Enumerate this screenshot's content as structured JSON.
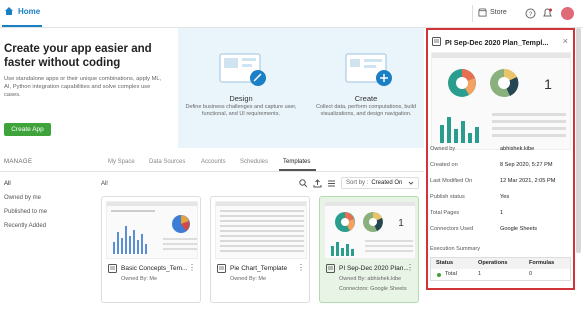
{
  "topbar": {
    "home_label": "Home",
    "store_label": "Store",
    "icons": [
      "home-icon",
      "store-icon",
      "help-icon",
      "notifications-icon",
      "avatar"
    ],
    "brand_color": "#1a7fc4",
    "avatar_color": "#e06a78"
  },
  "hero": {
    "title": "Create your app easier and faster without coding",
    "description": "Use standalone apps or their unique combinations, apply ML, AI, Python integration capabilities and solve complex use cases.",
    "create_button": "Create App",
    "steps": [
      {
        "title": "Design",
        "description": "Define business challenges and capture user, functional, and UI requirements."
      },
      {
        "title": "Create",
        "description": "Collect data, perform computations, build visualizations, and design navigation."
      }
    ]
  },
  "manage": {
    "label": "MANAGE",
    "tabs": [
      "My Space",
      "Data Sources",
      "Accounts",
      "Schedules",
      "Templates"
    ],
    "active_tab": "Templates",
    "sidebar": [
      "All",
      "Owned by me",
      "Published to me",
      "Recently Added"
    ],
    "list_label": "All",
    "sort_label": "Sort by :",
    "sort_value": "Created On"
  },
  "cards": [
    {
      "title": "Basic Concepts_Tem...",
      "owned_by": "Owned By: Me",
      "connectors": ""
    },
    {
      "title": "Pie Chart_Template",
      "owned_by": "Owned By: Me",
      "connectors": ""
    },
    {
      "title": "PI Sep-Dec 2020 Plan...",
      "owned_by": "Owned By: abhishek.kibe",
      "connectors": "Connectors: Google Sheets"
    }
  ],
  "panel": {
    "title": "PI Sep-Dec 2020 Plan_Templ...",
    "rows": [
      {
        "label": "Owned by",
        "value": "abhishek.kibe"
      },
      {
        "label": "Created on",
        "value": "8 Sep 2020, 5:27 PM"
      },
      {
        "label": "Last Modified On",
        "value": "12 Mar 2021, 2:05 PM"
      },
      {
        "label": "Publish status",
        "value": "Yes"
      },
      {
        "label": "Total Pages",
        "value": "1"
      },
      {
        "label": "Connectors Used",
        "value": "Google Sheets"
      }
    ],
    "execution_summary": "Execution Summary",
    "table_headers": [
      "Status",
      "Operations",
      "Formulas"
    ],
    "table_row": {
      "status": "Total",
      "operations": "1",
      "formulas": "0"
    },
    "highlight_color": "#d13438"
  }
}
